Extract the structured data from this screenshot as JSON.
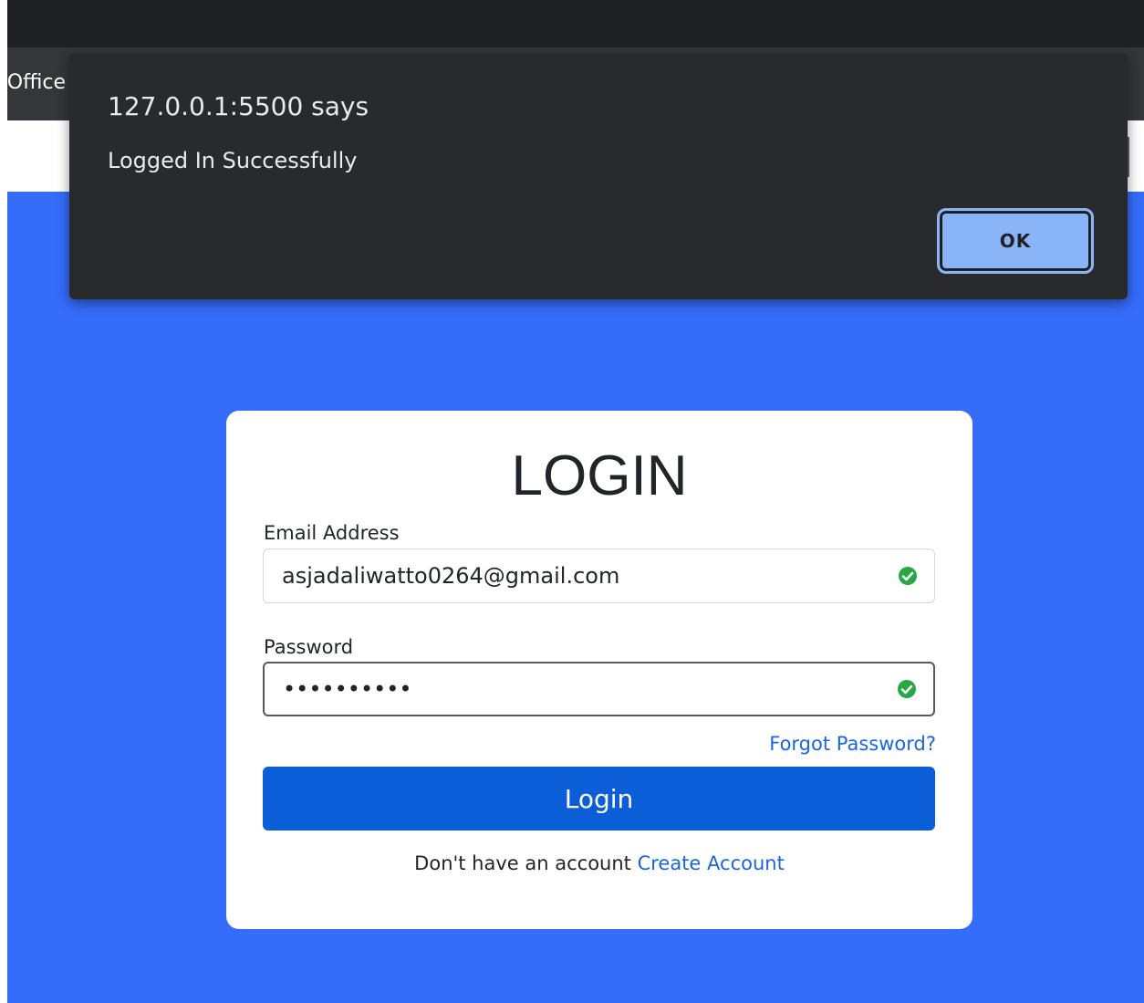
{
  "browser": {
    "bookmark_text": "Office"
  },
  "dialog": {
    "title": "127.0.0.1:5500 says",
    "message": "Logged In Successfully",
    "ok_label": "OK"
  },
  "login": {
    "title": "LOGIN",
    "email": {
      "label": "Email Address",
      "value": "asjadaliwatto0264@gmail.com",
      "valid": true
    },
    "password": {
      "label": "Password",
      "value": "••••••••••",
      "valid": true
    },
    "forgot_label": "Forgot Password?",
    "submit_label": "Login",
    "signup_prompt": "Don't have an account",
    "signup_link": "Create Account"
  },
  "colors": {
    "page_background": "#356cfa",
    "primary_button": "#0b5ed7",
    "link": "#1866df",
    "dialog_background": "#292a2d",
    "dialog_button": "#8ab4f8",
    "valid_check": "#28a745"
  }
}
